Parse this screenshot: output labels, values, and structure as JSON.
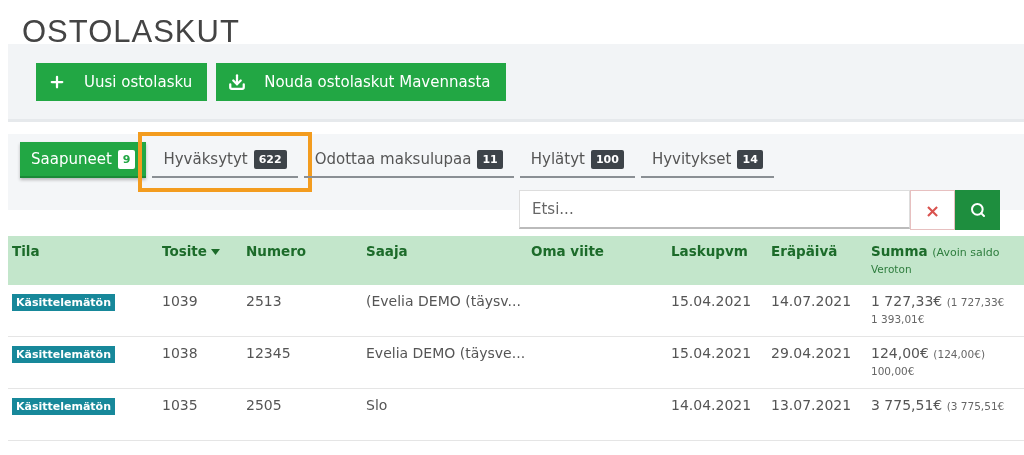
{
  "page_title": "OSTOLASKUT",
  "toolbar": {
    "buttons": [
      {
        "label": "Uusi ostolasku"
      },
      {
        "label": "Nouda ostolaskut Mavennasta"
      }
    ]
  },
  "tabs": [
    {
      "label": "Saapuneet",
      "count": "9",
      "selected": true,
      "highlighted": false
    },
    {
      "label": "Hyväksytyt",
      "count": "622",
      "selected": false,
      "highlighted": true
    },
    {
      "label": "Odottaa maksulupaa",
      "count": "11",
      "selected": false,
      "highlighted": false
    },
    {
      "label": "Hylätyt",
      "count": "100",
      "selected": false,
      "highlighted": false
    },
    {
      "label": "Hyvitykset",
      "count": "14",
      "selected": false,
      "highlighted": false
    }
  ],
  "search": {
    "placeholder": "Etsi...",
    "clear_label": "×"
  },
  "table": {
    "columns": [
      {
        "label": "Tila",
        "sorted": false
      },
      {
        "label": "Tosite",
        "sorted": true
      },
      {
        "label": "Numero",
        "sorted": false
      },
      {
        "label": "Saaja",
        "sorted": false
      },
      {
        "label": "Oma viite",
        "sorted": false
      },
      {
        "label": "Laskupvm",
        "sorted": false
      },
      {
        "label": "Eräpäivä",
        "sorted": false
      },
      {
        "label": "Summa",
        "note": "(Avoin saldo",
        "sub": "Veroton",
        "sorted": false
      }
    ],
    "rows": [
      {
        "status": "Käsittelemätön",
        "tosite": "1039",
        "numero": "2513",
        "saaja": "(Evelia DEMO (täysv...",
        "laskupvm": "15.04.2021",
        "erapaiva": "14.07.2021",
        "summa": "1 727,33€",
        "avoin": "(1 727,33€",
        "veroton": "1 393,01€"
      },
      {
        "status": "Käsittelemätön",
        "tosite": "1038",
        "numero": "12345",
        "saaja": "Evelia DEMO (täysve...",
        "laskupvm": "15.04.2021",
        "erapaiva": "29.04.2021",
        "summa": "124,00€",
        "avoin": "(124,00€)",
        "veroton": "100,00€"
      },
      {
        "status": "Käsittelemätön",
        "tosite": "1035",
        "numero": "2505",
        "saaja": "Slo",
        "laskupvm": "14.04.2021",
        "erapaiva": "13.07.2021",
        "summa": "3 775,51€",
        "avoin": "(3 775,51€"
      }
    ]
  }
}
